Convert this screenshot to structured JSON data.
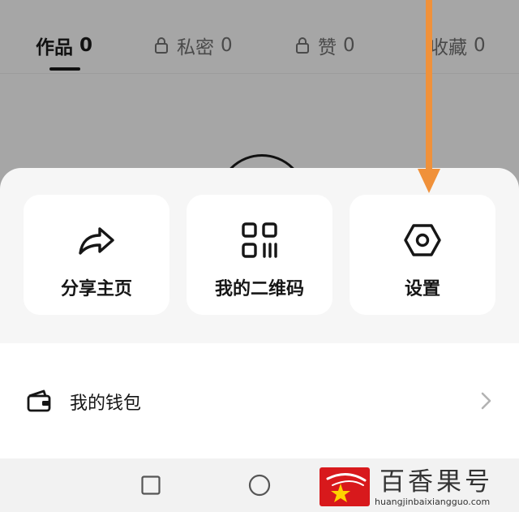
{
  "tabs": [
    {
      "label": "作品",
      "count": "0",
      "locked": false,
      "active": true
    },
    {
      "label": "私密",
      "count": "0",
      "locked": true,
      "active": false
    },
    {
      "label": "赞",
      "count": "0",
      "locked": true,
      "active": false
    },
    {
      "label": "收藏",
      "count": "0",
      "locked": false,
      "active": false
    }
  ],
  "sheet": {
    "actions": [
      {
        "label": "分享主页",
        "icon": "share-arrow-icon"
      },
      {
        "label": "我的二维码",
        "icon": "qr-code-icon"
      },
      {
        "label": "设置",
        "icon": "hexagon-gear-icon"
      }
    ],
    "wallet": {
      "label": "我的钱包",
      "icon": "wallet-icon"
    }
  },
  "navbar": {
    "icons": [
      "recent-apps-square-icon",
      "home-circle-icon"
    ]
  },
  "watermark": {
    "brand": "百香果号",
    "url": "huangjinbaixiangguo.com"
  },
  "colors": {
    "annotation_arrow": "#f0913a",
    "sheet_bg": "#f6f6f6",
    "dim_bg": "#a6a6a6"
  }
}
